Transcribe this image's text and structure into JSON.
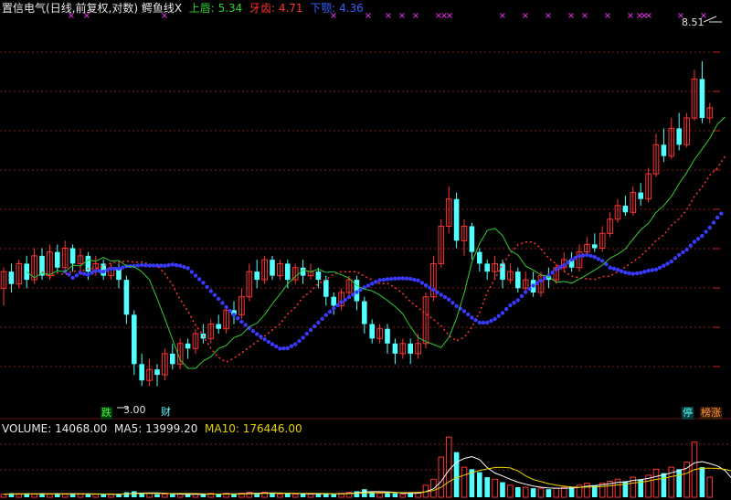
{
  "header": {
    "name": "置信电气",
    "mode": "(日线,前复权,对数)",
    "indicator": "鳄鱼线X",
    "upper_label": "上唇:",
    "upper_value": "5.34",
    "teeth_label": "牙齿:",
    "teeth_value": "4.71",
    "jaw_label": "下颚:",
    "jaw_value": "4.36"
  },
  "price_labels": {
    "high": "8.51",
    "low": "3.00"
  },
  "tags": {
    "die": "跌",
    "cai": "财",
    "ting": "停",
    "zhang": "榜涨"
  },
  "volume_header": {
    "volume_label": "VOLUME:",
    "volume_value": "14068.00",
    "ma5_label": "MA5:",
    "ma5_value": "13999.20",
    "ma10_label": "MA10:",
    "ma10_value": "176446.00"
  },
  "colors": {
    "up": "#ff3333",
    "down": "#54ffff",
    "lips": "#33cc33",
    "teeth": "#ff3333",
    "jaw": "#3a3aff",
    "marker": "#ff33ff",
    "grid": "#8a1a1a",
    "vol_ma5": "#ffffff",
    "vol_ma10": "#e6d200"
  },
  "chart_data": {
    "type": "candlestick",
    "candles": [
      [
        4.0,
        4.2,
        3.8,
        4.25
      ],
      [
        4.2,
        4.05,
        3.95,
        4.3
      ],
      [
        4.05,
        4.3,
        4.0,
        4.35
      ],
      [
        4.3,
        4.1,
        4.0,
        4.4
      ],
      [
        4.1,
        4.4,
        4.05,
        4.5
      ],
      [
        4.4,
        4.15,
        4.1,
        4.5
      ],
      [
        4.15,
        4.45,
        4.1,
        4.55
      ],
      [
        4.45,
        4.25,
        4.2,
        4.55
      ],
      [
        4.25,
        4.5,
        4.2,
        4.6
      ],
      [
        4.5,
        4.3,
        4.2,
        4.55
      ],
      [
        4.3,
        4.4,
        4.2,
        4.5
      ],
      [
        4.4,
        4.2,
        4.1,
        4.45
      ],
      [
        4.2,
        4.3,
        4.15,
        4.4
      ],
      [
        4.3,
        4.15,
        4.1,
        4.35
      ],
      [
        4.15,
        4.25,
        4.1,
        4.3
      ],
      [
        4.25,
        4.1,
        4.0,
        4.3
      ],
      [
        4.1,
        3.7,
        3.6,
        4.15
      ],
      [
        3.7,
        3.2,
        3.1,
        3.75
      ],
      [
        3.2,
        3.05,
        3.0,
        3.3
      ],
      [
        3.05,
        3.15,
        3.0,
        3.25
      ],
      [
        3.15,
        3.1,
        3.0,
        3.2
      ],
      [
        3.1,
        3.3,
        3.05,
        3.35
      ],
      [
        3.3,
        3.2,
        3.15,
        3.4
      ],
      [
        3.2,
        3.4,
        3.15,
        3.45
      ],
      [
        3.4,
        3.35,
        3.25,
        3.45
      ],
      [
        3.35,
        3.5,
        3.3,
        3.55
      ],
      [
        3.5,
        3.45,
        3.4,
        3.6
      ],
      [
        3.45,
        3.6,
        3.4,
        3.65
      ],
      [
        3.6,
        3.55,
        3.5,
        3.7
      ],
      [
        3.55,
        3.75,
        3.5,
        3.8
      ],
      [
        3.75,
        3.7,
        3.6,
        3.85
      ],
      [
        3.7,
        3.9,
        3.65,
        4.0
      ],
      [
        3.9,
        4.2,
        3.85,
        4.3
      ],
      [
        4.2,
        4.1,
        4.0,
        4.35
      ],
      [
        4.1,
        4.35,
        4.05,
        4.4
      ],
      [
        4.35,
        4.15,
        4.1,
        4.4
      ],
      [
        4.15,
        4.3,
        4.1,
        4.35
      ],
      [
        4.3,
        4.1,
        4.0,
        4.35
      ],
      [
        4.1,
        4.25,
        4.05,
        4.3
      ],
      [
        4.25,
        4.15,
        4.05,
        4.35
      ],
      [
        4.15,
        4.2,
        4.1,
        4.3
      ],
      [
        4.2,
        4.1,
        4.0,
        4.25
      ],
      [
        4.1,
        3.9,
        3.8,
        4.15
      ],
      [
        3.9,
        3.8,
        3.7,
        3.95
      ],
      [
        3.8,
        3.95,
        3.75,
        4.0
      ],
      [
        3.95,
        4.1,
        3.9,
        4.15
      ],
      [
        4.1,
        3.85,
        3.75,
        4.15
      ],
      [
        3.85,
        3.6,
        3.5,
        3.9
      ],
      [
        3.6,
        3.45,
        3.4,
        3.65
      ],
      [
        3.45,
        3.55,
        3.4,
        3.6
      ],
      [
        3.55,
        3.4,
        3.3,
        3.6
      ],
      [
        3.4,
        3.3,
        3.2,
        3.45
      ],
      [
        3.3,
        3.4,
        3.25,
        3.45
      ],
      [
        3.4,
        3.3,
        3.2,
        3.45
      ],
      [
        3.3,
        3.4,
        3.25,
        3.5
      ],
      [
        3.4,
        3.9,
        3.35,
        3.95
      ],
      [
        3.9,
        4.3,
        3.85,
        4.4
      ],
      [
        4.3,
        4.8,
        4.25,
        4.9
      ],
      [
        4.8,
        5.2,
        4.7,
        5.4
      ],
      [
        5.2,
        4.6,
        4.5,
        5.3
      ],
      [
        4.6,
        4.8,
        4.4,
        4.9
      ],
      [
        4.8,
        4.45,
        4.35,
        4.85
      ],
      [
        4.45,
        4.3,
        4.2,
        4.5
      ],
      [
        4.3,
        4.2,
        4.1,
        4.35
      ],
      [
        4.2,
        4.3,
        4.1,
        4.4
      ],
      [
        4.3,
        4.1,
        4.0,
        4.35
      ],
      [
        4.1,
        4.2,
        4.05,
        4.3
      ],
      [
        4.2,
        4.0,
        3.95,
        4.25
      ],
      [
        4.0,
        4.1,
        3.95,
        4.2
      ],
      [
        4.1,
        3.95,
        3.9,
        4.2
      ],
      [
        3.95,
        4.15,
        3.9,
        4.2
      ],
      [
        4.15,
        4.1,
        4.0,
        4.25
      ],
      [
        4.1,
        4.25,
        4.05,
        4.3
      ],
      [
        4.25,
        4.35,
        4.2,
        4.45
      ],
      [
        4.35,
        4.25,
        4.2,
        4.45
      ],
      [
        4.25,
        4.45,
        4.2,
        4.55
      ],
      [
        4.45,
        4.55,
        4.4,
        4.65
      ],
      [
        4.55,
        4.5,
        4.45,
        4.7
      ],
      [
        4.5,
        4.7,
        4.45,
        4.8
      ],
      [
        4.7,
        4.9,
        4.65,
        5.0
      ],
      [
        4.9,
        5.1,
        4.85,
        5.2
      ],
      [
        5.1,
        5.0,
        4.95,
        5.25
      ],
      [
        5.0,
        5.3,
        4.95,
        5.4
      ],
      [
        5.3,
        5.2,
        5.1,
        5.45
      ],
      [
        5.2,
        5.6,
        5.15,
        5.7
      ],
      [
        5.6,
        6.1,
        5.55,
        6.3
      ],
      [
        6.1,
        5.9,
        5.8,
        6.4
      ],
      [
        5.9,
        6.4,
        5.85,
        6.6
      ],
      [
        6.4,
        6.1,
        6.0,
        6.7
      ],
      [
        6.1,
        6.6,
        6.05,
        6.7
      ],
      [
        6.6,
        7.4,
        6.55,
        7.6
      ],
      [
        7.4,
        6.6,
        6.5,
        7.8
      ],
      [
        6.6,
        6.8,
        6.5,
        6.9
      ]
    ],
    "volume": [
      3,
      4,
      3,
      4,
      3,
      4,
      3,
      4,
      3,
      4,
      3,
      3,
      3,
      3,
      3,
      3,
      5,
      6,
      4,
      4,
      3,
      3,
      3,
      3,
      3,
      3,
      3,
      4,
      3,
      4,
      3,
      4,
      5,
      4,
      5,
      4,
      3,
      4,
      3,
      4,
      3,
      3,
      4,
      3,
      4,
      5,
      6,
      8,
      5,
      4,
      4,
      4,
      3,
      4,
      5,
      12,
      18,
      40,
      60,
      45,
      30,
      28,
      25,
      20,
      18,
      15,
      12,
      10,
      10,
      9,
      9,
      8,
      9,
      10,
      10,
      12,
      14,
      12,
      14,
      16,
      18,
      16,
      20,
      18,
      22,
      28,
      24,
      30,
      28,
      35,
      55,
      30,
      20,
      16,
      12,
      10,
      8
    ]
  }
}
